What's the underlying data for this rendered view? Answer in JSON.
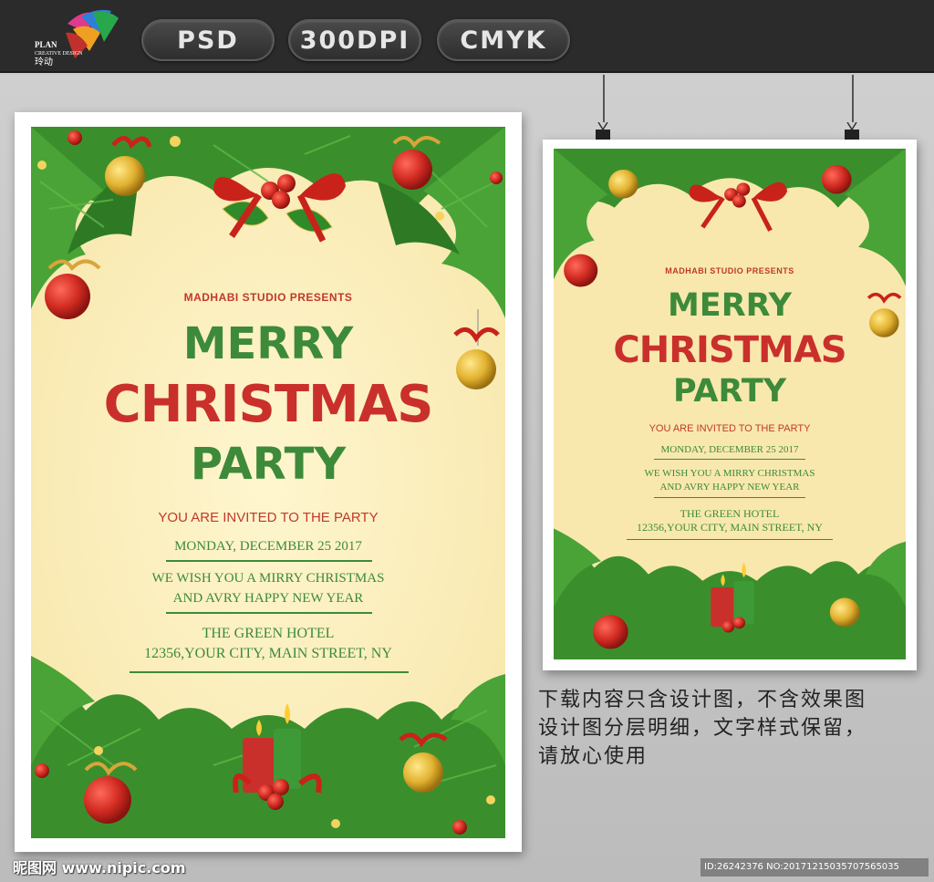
{
  "topbar": {
    "badges": [
      "PSD",
      "300DPI",
      "CMYK"
    ],
    "logo": {
      "line1": "PLAN",
      "line2": "CREATIVE DESIGN",
      "line3": "玲动"
    }
  },
  "poster": {
    "studio": "MADHABI STUDIO PRESENTS",
    "merry": "MERRY",
    "christmas": "CHRISTMAS",
    "party": "PARTY",
    "invited": "YOU ARE INVITED TO THE PARTY",
    "date": "MONDAY, DECEMBER 25 2017",
    "wish1": "WE WISH YOU A MIRRY CHRISTMAS",
    "wish2": "AND AVRY HAPPY NEW YEAR",
    "venue": "THE GREEN HOTEL",
    "address": "12356,YOUR CITY, MAIN STREET, NY"
  },
  "caption": {
    "line1": "下载内容只含设计图，不含效果图",
    "line2": "设计图分层明细，文字样式保留，",
    "line3": "请放心使用"
  },
  "footer": {
    "site": "昵图网 www.nipic.com",
    "id": "ID:26242376 NO:20171215035707565035"
  },
  "colors": {
    "poster_bg": "#f8e8ae",
    "green": "#3d8a3a",
    "red": "#c9302c",
    "topbar": "#2b2b2b"
  }
}
